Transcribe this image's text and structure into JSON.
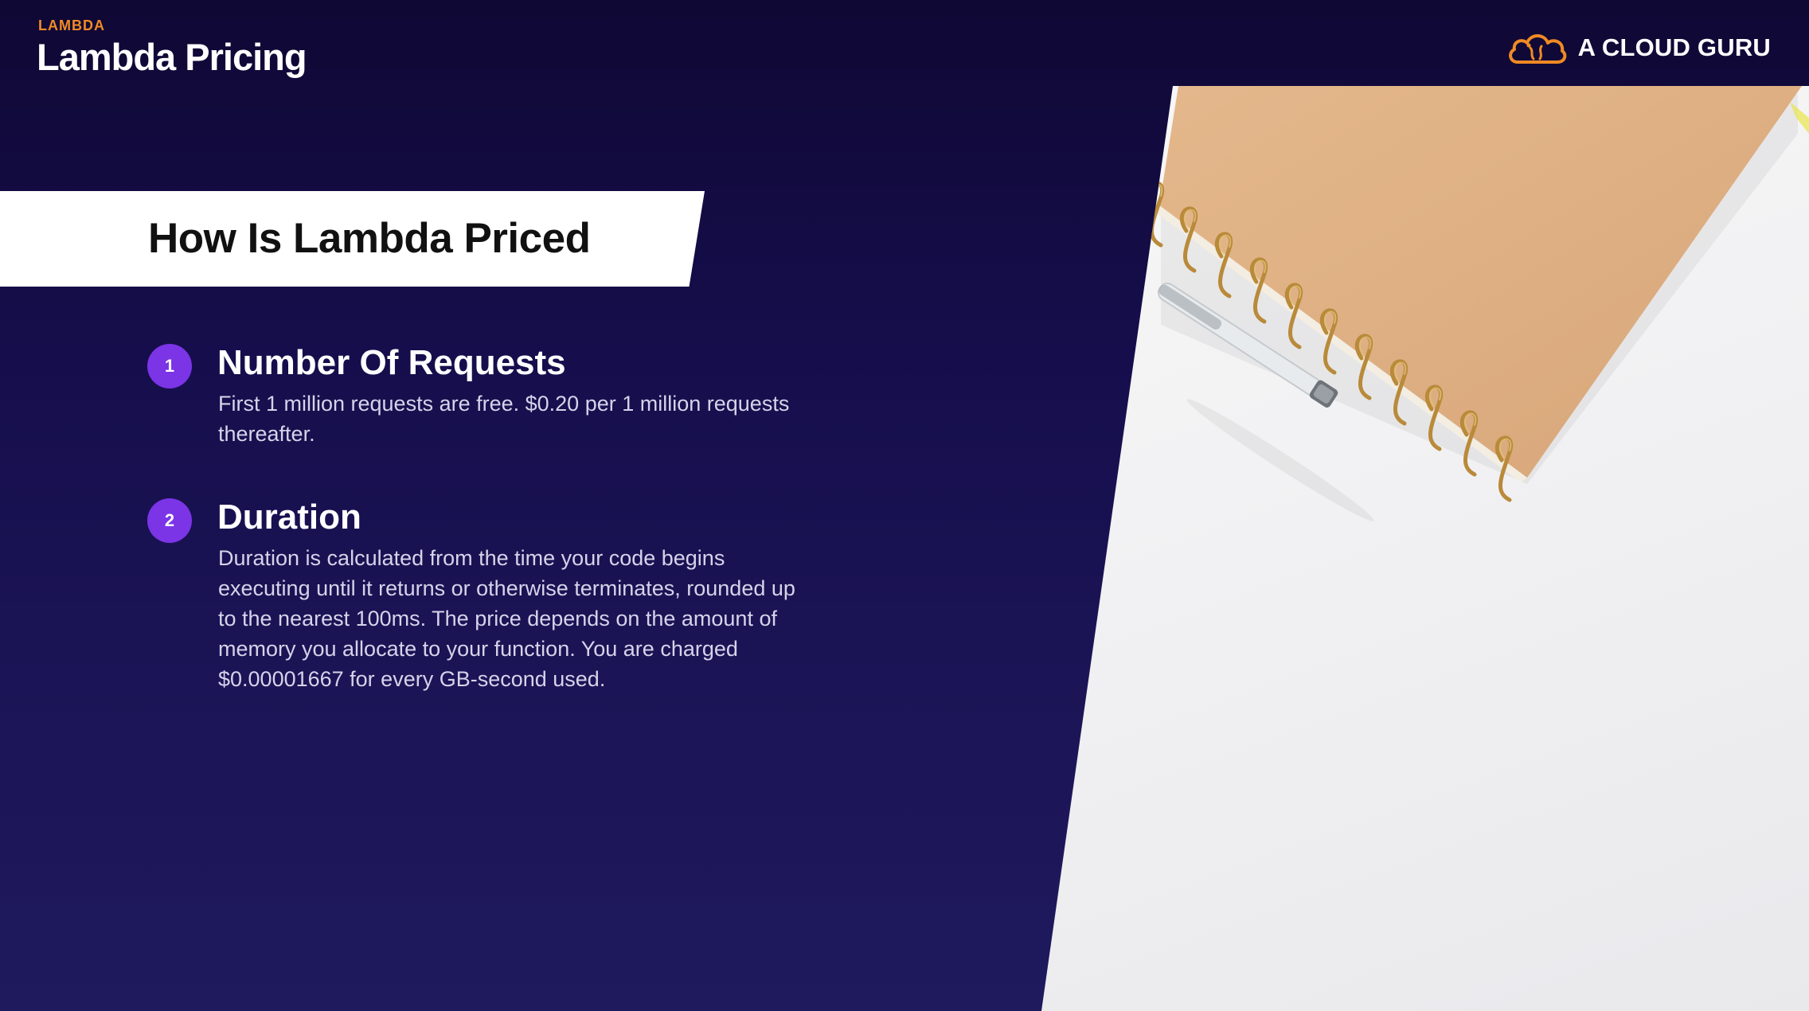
{
  "header": {
    "kicker": "LAMBDA",
    "title": "Lambda Pricing",
    "brand_name": "A CLOUD GURU",
    "brand_icon": "cloud-logo-icon",
    "kicker_color": "#f08a24"
  },
  "section": {
    "title": "How Is Lambda Priced"
  },
  "items": [
    {
      "number": "1",
      "title": "Number Of Requests",
      "body": "First 1 million requests are free. $0.20 per 1 million requests thereafter."
    },
    {
      "number": "2",
      "title": "Duration",
      "body": "Duration is calculated from the time your code begins executing until it returns or otherwise terminates, rounded up to the nearest 100ms. The price depends on the amount of memory you allocate to your function. You are charged $0.00001667 for every GB-second used."
    }
  ],
  "colors": {
    "background": "#160e4c",
    "accent_purple": "#7b34e6",
    "brand_orange": "#f08a24"
  }
}
